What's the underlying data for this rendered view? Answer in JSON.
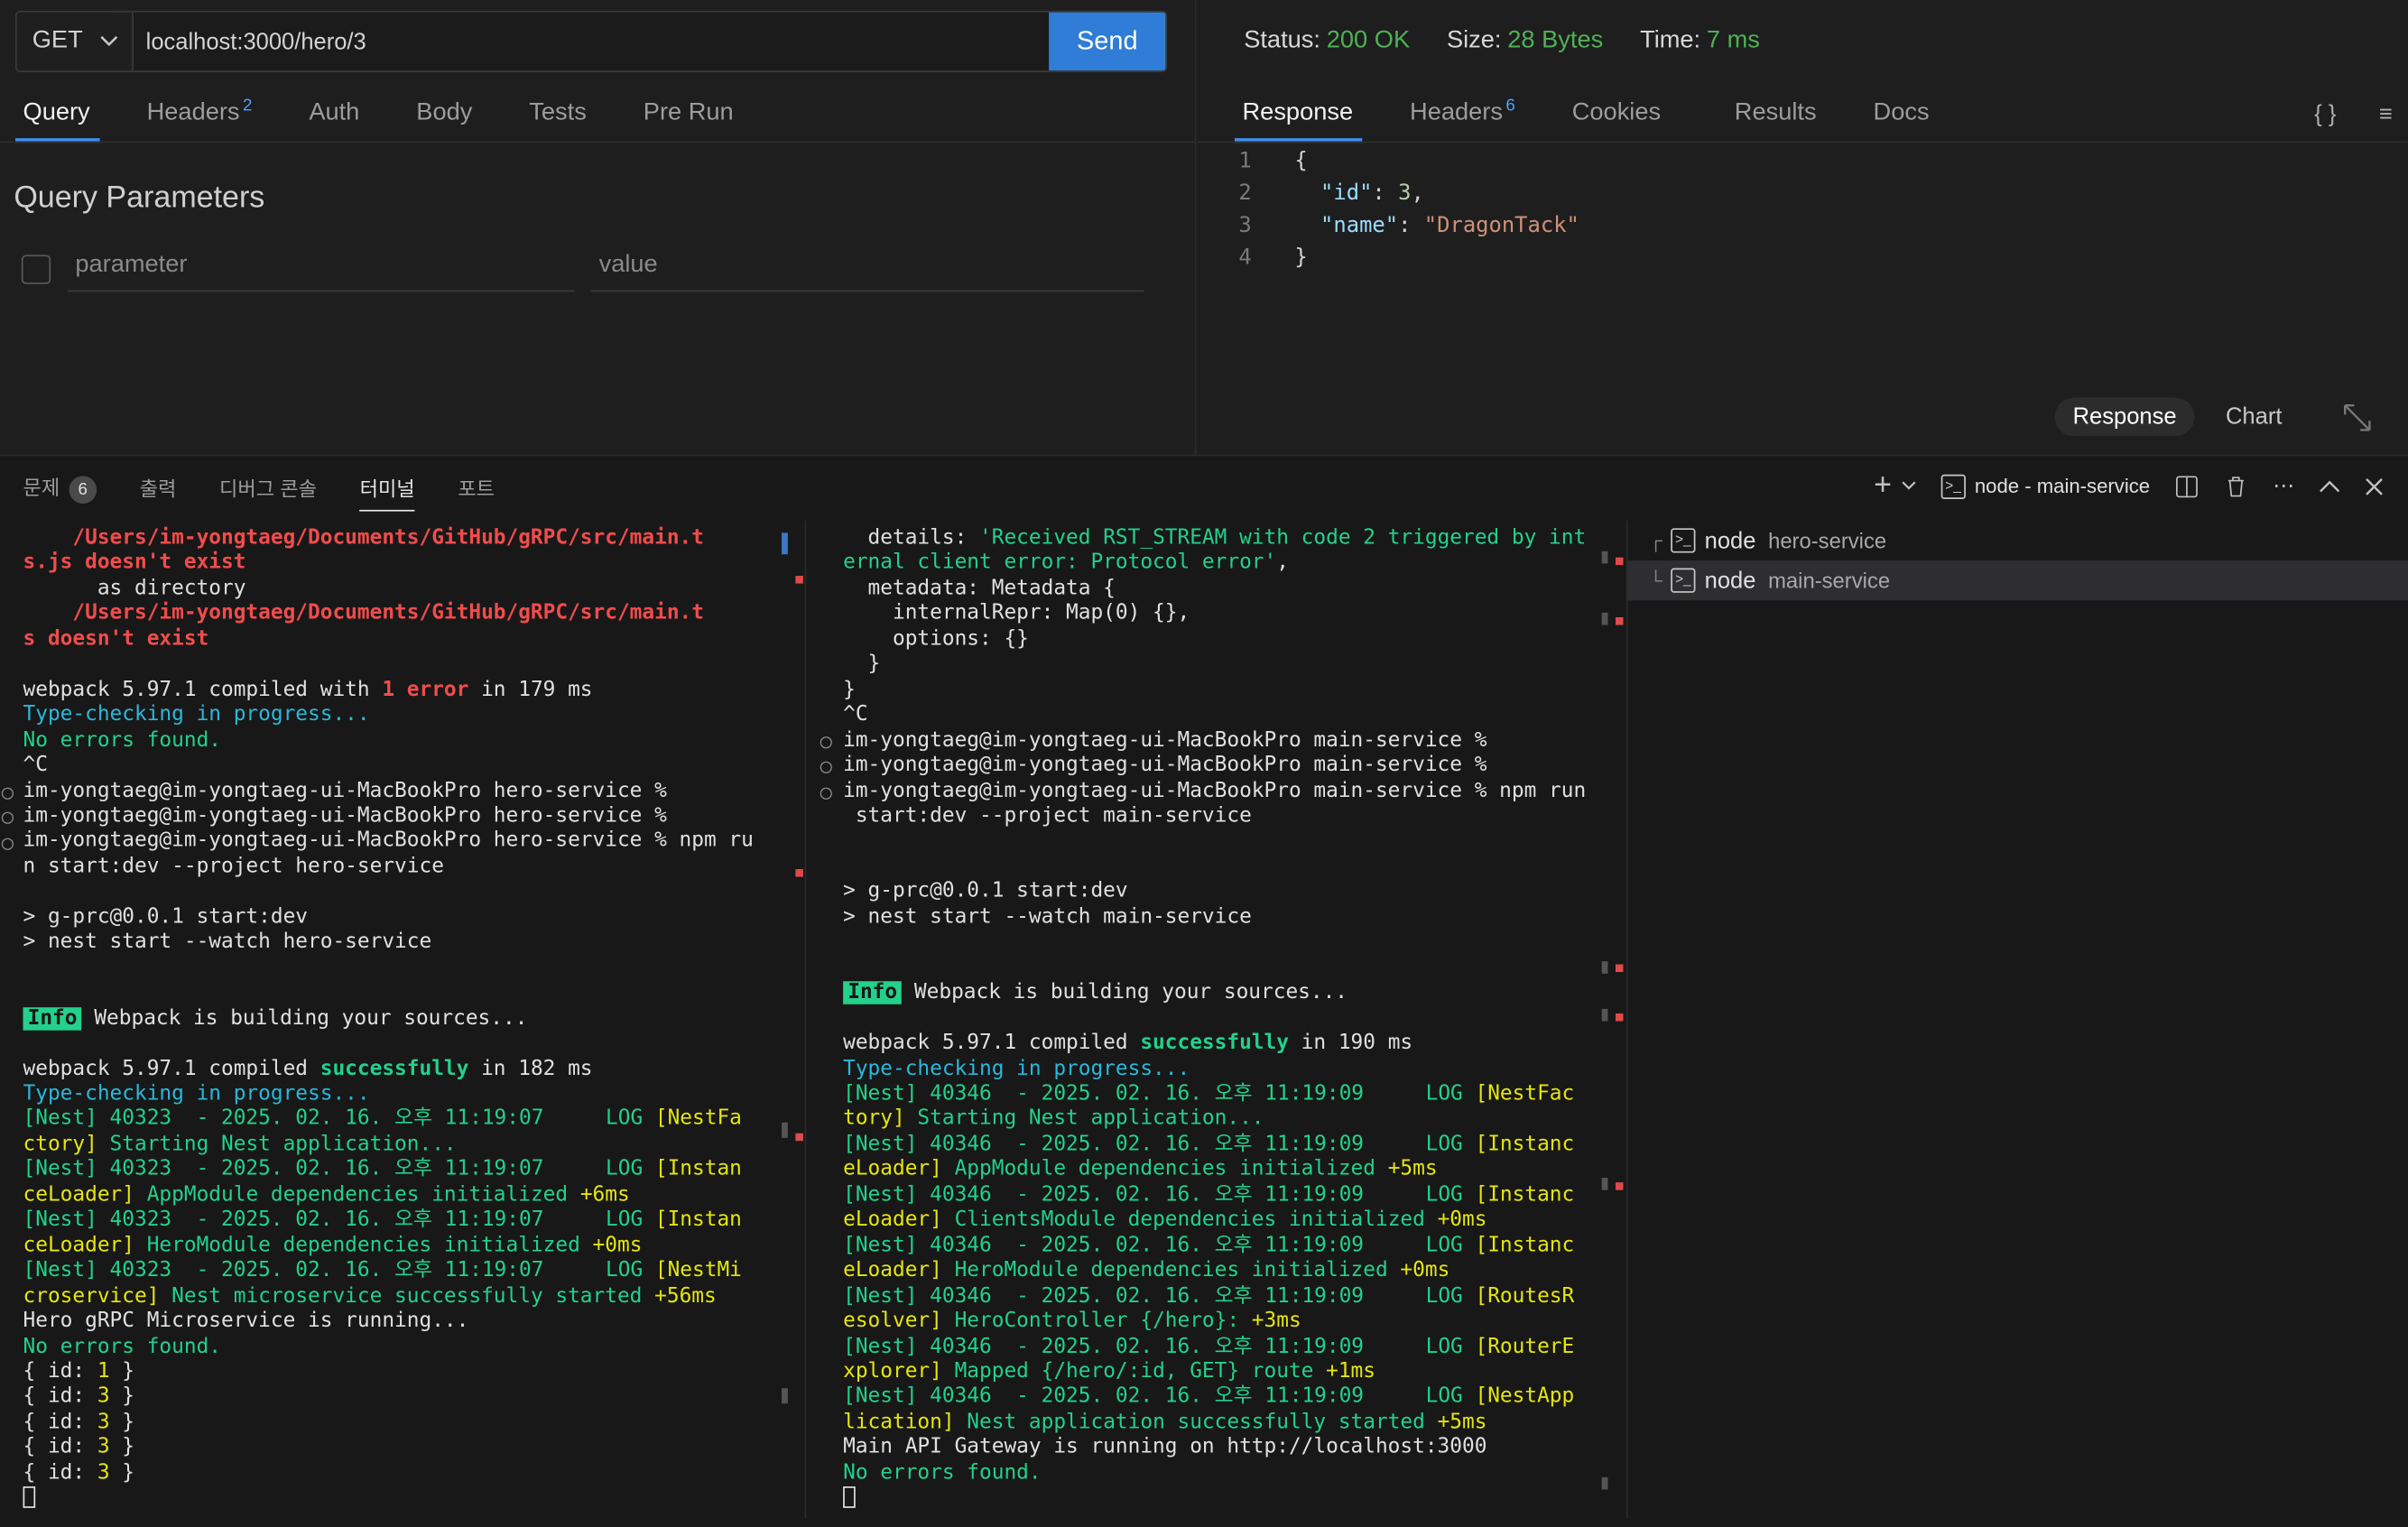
{
  "request": {
    "method": "GET",
    "url": "localhost:3000/hero/3",
    "send_label": "Send",
    "tabs": [
      {
        "label": "Query"
      },
      {
        "label": "Headers",
        "badge": "2"
      },
      {
        "label": "Auth"
      },
      {
        "label": "Body"
      },
      {
        "label": "Tests"
      },
      {
        "label": "Pre Run"
      }
    ],
    "query_title": "Query Parameters",
    "param_placeholder": "parameter",
    "value_placeholder": "value"
  },
  "response": {
    "status_label": "Status:",
    "status_value": "200 OK",
    "size_label": "Size:",
    "size_value": "28 Bytes",
    "time_label": "Time:",
    "time_value": "7 ms",
    "tabs": [
      {
        "label": "Response"
      },
      {
        "label": "Headers",
        "badge": "6"
      },
      {
        "label": "Cookies"
      },
      {
        "label": "Results"
      },
      {
        "label": "Docs"
      }
    ],
    "icons": {
      "braces": "{ }",
      "wrap": "≡"
    },
    "lines": [
      "1",
      "2",
      "3",
      "4"
    ],
    "json": {
      "open": "{",
      "id_key": "\"id\"",
      "id_value": "3",
      "name_key": "\"name\"",
      "name_value": "\"DragonTack\"",
      "close": "}"
    },
    "view_response": "Response",
    "view_chart": "Chart"
  },
  "panel": {
    "tabs": [
      {
        "label": "문제",
        "badge": "6"
      },
      {
        "label": "출력"
      },
      {
        "label": "디버그 콘솔"
      },
      {
        "label": "터미널"
      },
      {
        "label": "포트"
      }
    ],
    "active_terminal": "node - main-service",
    "terminals": [
      {
        "name": "node",
        "sub": "hero-service"
      },
      {
        "name": "node",
        "sub": "main-service"
      }
    ]
  },
  "term1": {
    "l1": "/Users/im-yongtaeg/Documents/GitHub/gRPC/src/main.t",
    "l2": "s.js doesn't exist",
    "l3": "      as directory",
    "l4": "/Users/im-yongtaeg/Documents/GitHub/gRPC/src/main.t",
    "l5": "s doesn't exist",
    "wp1": "webpack 5.97.1 compiled with ",
    "wp1err": "1 error",
    "wp1end": " in 179 ms",
    "tc1": "Type-checking in progress...",
    "ne1": "No errors found.",
    "ctrlc": "^C",
    "p1": "im-yongtaeg@im-yongtaeg-ui-MacBookPro hero-service %",
    "p2": "im-yongtaeg@im-yongtaeg-ui-MacBookPro hero-service %",
    "p3": "im-yongtaeg@im-yongtaeg-ui-MacBookPro hero-service % npm ru",
    "p3b": "n start:dev --project hero-service",
    "s1": "> g-prc@0.0.1 start:dev",
    "s2": "> nest start --watch hero-service",
    "info": "Info",
    "info_text": " Webpack is building your sources...",
    "wp2": "webpack 5.97.1 compiled ",
    "wp2ok": "successfully",
    "wp2end": " in 182 ms",
    "tc2": "Type-checking in progress...",
    "n1a": "[Nest] 40323  - 2025. 02. 16. 오후 11:19:07     LOG ",
    "n1b": "[NestFa",
    "n1c": "ctory]",
    "n1d": " Starting Nest application...",
    "n2a": "[Nest] 40323  - 2025. 02. 16. 오후 11:19:07     LOG ",
    "n2b": "[Instan",
    "n2c": "ceLoader]",
    "n2d": " AppModule dependencies initialized ",
    "n2e": "+6ms",
    "n3a": "[Nest] 40323  - 2025. 02. 16. 오후 11:19:07     LOG ",
    "n3b": "[Instan",
    "n3c": "ceLoader]",
    "n3d": " HeroModule dependencies initialized ",
    "n3e": "+0ms",
    "n4a": "[Nest] 40323  - 2025. 02. 16. 오후 11:19:07     LOG ",
    "n4b": "[NestMi",
    "n4c": "croservice]",
    "n4d": " Nest microservice successfully started ",
    "n4e": "+56ms",
    "hero_run": "Hero gRPC Microservice is running...",
    "ne2": "No errors found.",
    "ids": [
      {
        "a": "{ id: ",
        "v": "1",
        "b": " }"
      },
      {
        "a": "{ id: ",
        "v": "3",
        "b": " }"
      },
      {
        "a": "{ id: ",
        "v": "3",
        "b": " }"
      },
      {
        "a": "{ id: ",
        "v": "3",
        "b": " }"
      },
      {
        "a": "{ id: ",
        "v": "3",
        "b": " }"
      }
    ]
  },
  "term2": {
    "d1a": "  details: ",
    "d1b": "'Received RST_STREAM with code 2 triggered by int",
    "d2": "ernal client error: Protocol error'",
    "d2c": ",",
    "d3": "  metadata: Metadata {",
    "d4": "    internalRepr: Map(0) {},",
    "d5": "    options: {}",
    "d6": "  }",
    "d7": "}",
    "ctrlc": "^C",
    "p1": "im-yongtaeg@im-yongtaeg-ui-MacBookPro main-service %",
    "p2": "im-yongtaeg@im-yongtaeg-ui-MacBookPro main-service %",
    "p3": "im-yongtaeg@im-yongtaeg-ui-MacBookPro main-service % npm run",
    "p3b": " start:dev --project main-service",
    "s1": "> g-prc@0.0.1 start:dev",
    "s2": "> nest start --watch main-service",
    "info": "Info",
    "info_text": " Webpack is building your sources...",
    "wp": "webpack 5.97.1 compiled ",
    "wpok": "successfully",
    "wpend": " in 190 ms",
    "tc": "Type-checking in progress...",
    "n1a": "[Nest] 40346  - 2025. 02. 16. 오후 11:19:09     LOG ",
    "n1b": "[NestFac",
    "n1c": "tory]",
    "n1d": " Starting Nest application...",
    "n2a": "[Nest] 40346  - 2025. 02. 16. 오후 11:19:09     LOG ",
    "n2b": "[Instanc",
    "n2c": "eLoader]",
    "n2d": " AppModule dependencies initialized ",
    "n2e": "+5ms",
    "n3a": "[Nest] 40346  - 2025. 02. 16. 오후 11:19:09     LOG ",
    "n3b": "[Instanc",
    "n3c": "eLoader]",
    "n3d": " ClientsModule dependencies initialized ",
    "n3e": "+0ms",
    "n4a": "[Nest] 40346  - 2025. 02. 16. 오후 11:19:09     LOG ",
    "n4b": "[Instanc",
    "n4c": "eLoader]",
    "n4d": " HeroModule dependencies initialized ",
    "n4e": "+0ms",
    "n5a": "[Nest] 40346  - 2025. 02. 16. 오후 11:19:09     LOG ",
    "n5b": "[RoutesR",
    "n5c": "esolver]",
    "n5d": " HeroController {/hero}: ",
    "n5e": "+3ms",
    "n6a": "[Nest] 40346  - 2025. 02. 16. 오후 11:19:09     LOG ",
    "n6b": "[RouterE",
    "n6c": "xplorer]",
    "n6d": " Mapped {/hero/:id, GET} route ",
    "n6e": "+1ms",
    "n7a": "[Nest] 40346  - 2025. 02. 16. 오후 11:19:09     LOG ",
    "n7b": "[NestApp",
    "n7c": "lication]",
    "n7d": " Nest application successfully started ",
    "n7e": "+5ms",
    "gw": "Main API Gateway is running on http://localhost:3000",
    "ne": "No errors found."
  },
  "colors": {
    "accent": "#2f7dd6",
    "ok": "#4fb155",
    "error": "#f14c4c",
    "log_green": "#23d18b",
    "log_yellow": "#e5e510",
    "cyan": "#29b8db"
  }
}
